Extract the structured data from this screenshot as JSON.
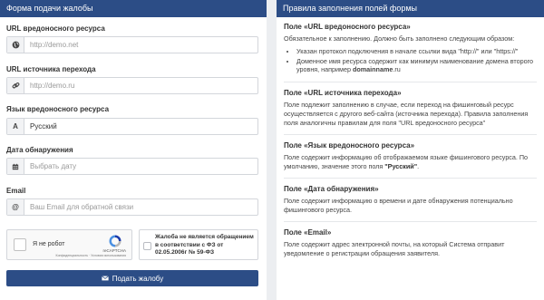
{
  "form": {
    "title": "Форма подачи жалобы",
    "fields": [
      {
        "label": "URL вредоносного ресурса",
        "icon": "globe-icon",
        "placeholder": "http://demo.net",
        "filled": false
      },
      {
        "label": "URL источника перехода",
        "icon": "link-icon",
        "placeholder": "http://demo.ru",
        "filled": false
      },
      {
        "label": "Язык вредоносного ресурса",
        "icon": "font-icon",
        "placeholder": "Русский",
        "filled": true
      },
      {
        "label": "Дата обнаружения",
        "icon": "calendar-icon",
        "placeholder": "Выбрать дату",
        "filled": false
      },
      {
        "label": "Email",
        "icon": "at-icon",
        "placeholder": "Ваш Email для обратной связи",
        "filled": false
      }
    ],
    "captcha": {
      "label": "Я не робот",
      "brand": "reCAPTCHA",
      "links": "Конфиденциальность · Условия использования"
    },
    "declaration": "Жалоба не является обращением в соответствии с ФЗ от 02.05.2006г № 59-ФЗ",
    "submit_label": "Подать жалобу",
    "accent": "#2c4d86"
  },
  "rules": {
    "title": "Правила заполнения полей формы",
    "sections": [
      {
        "title": "Поле «URL вредоносного ресурса»",
        "text": "Обязательное к заполнению. Должно быть заполнено следующим образом:",
        "bullets": [
          "Указан протокол подключения в начале ссылки вида \"http://\" или \"https://\"",
          "Доменное имя ресурса содержит как минимум наименование домена второго уровня, например"
        ],
        "bullet_bold": "domainname",
        "bullet_tail": ".ru"
      },
      {
        "title": "Поле «URL источника перехода»",
        "text": "Поле подлежит заполнению в случае, если переход на фишинговый ресурс осуществляется с другого веб-сайта (источника перехода). Правила заполнения поля аналогичны правилам для поля \"URL вредоносного ресурса\""
      },
      {
        "title": "Поле «Язык вредоносного ресурса»",
        "text": "Поле содержит информацию об отображаемом языке фишингового ресурса. По умолчанию, значение этого поля",
        "bold": "\"Русский\"",
        "tail": "."
      },
      {
        "title": "Поле «Дата обнаружения»",
        "text": "Поле содержит информацию о времени и дате обнаружения потенциально фишингового ресурса."
      },
      {
        "title": "Поле «Email»",
        "text": "Поле содержит адрес электронной почты, на который Система отправит уведомление о регистрации обращения заявителя."
      }
    ]
  }
}
